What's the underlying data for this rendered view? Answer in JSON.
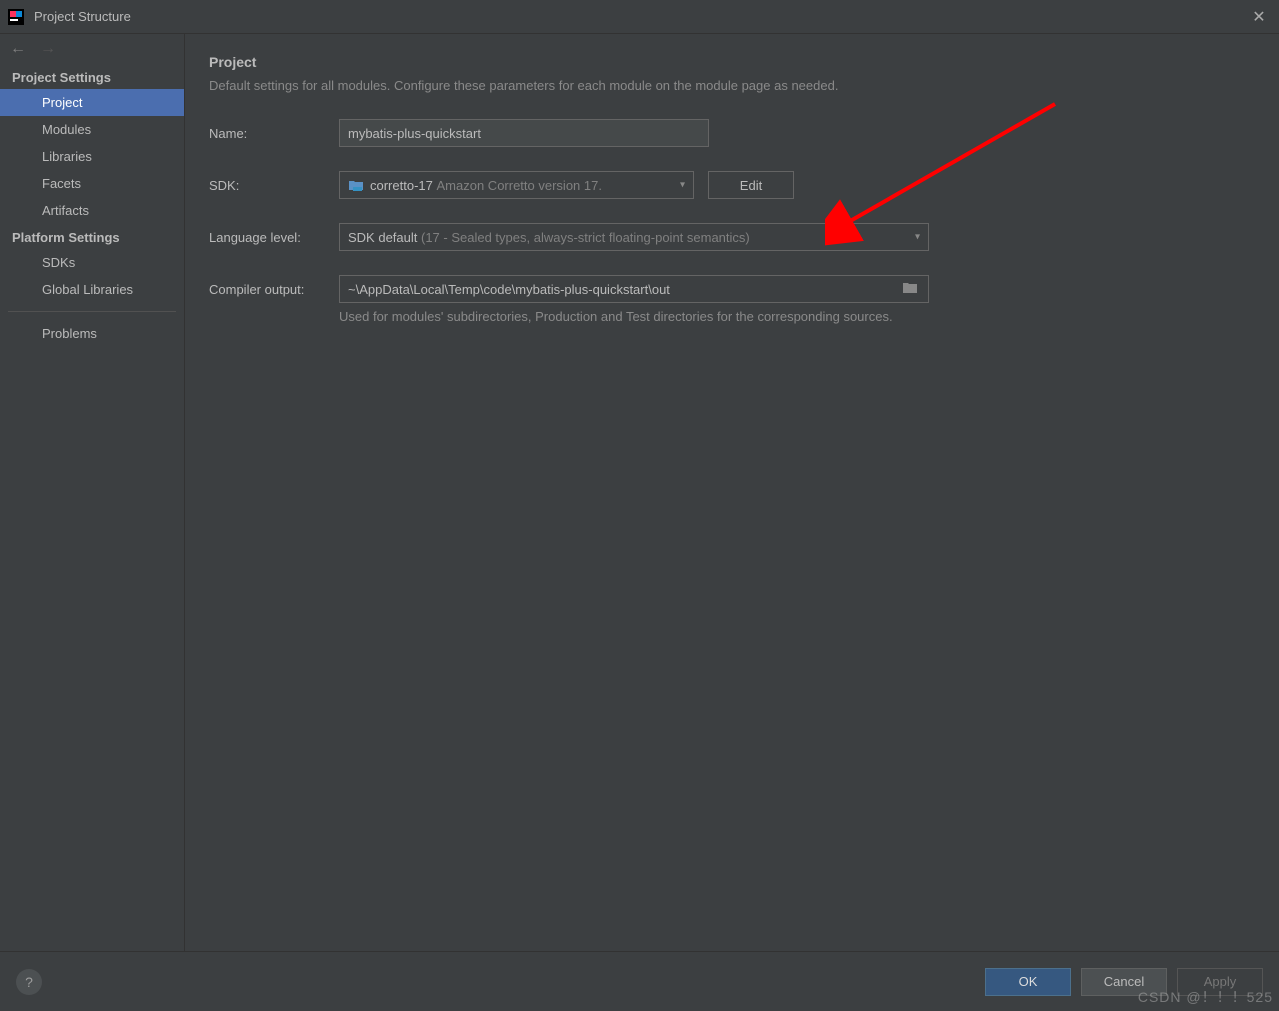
{
  "window": {
    "title": "Project Structure"
  },
  "sidebar": {
    "section1_label": "Project Settings",
    "section2_label": "Platform Settings",
    "items1": [
      "Project",
      "Modules",
      "Libraries",
      "Facets",
      "Artifacts"
    ],
    "items2": [
      "SDKs",
      "Global Libraries"
    ],
    "problems_label": "Problems",
    "selected": "Project"
  },
  "main": {
    "heading": "Project",
    "subtitle": "Default settings for all modules. Configure these parameters for each module on the module page as needed.",
    "name_label": "Name:",
    "name_value": "mybatis-plus-quickstart",
    "sdk_label": "SDK:",
    "sdk_name": "corretto-17",
    "sdk_detail": "Amazon Corretto version 17.",
    "edit_label": "Edit",
    "lang_label": "Language level:",
    "lang_value": "SDK default",
    "lang_detail": "(17 - Sealed types, always-strict floating-point semantics)",
    "output_label": "Compiler output:",
    "output_value": "~\\AppData\\Local\\Temp\\code\\mybatis-plus-quickstart\\out",
    "output_help": "Used for modules' subdirectories, Production and Test directories for the corresponding sources."
  },
  "footer": {
    "ok": "OK",
    "cancel": "Cancel",
    "apply": "Apply"
  },
  "watermark": "CSDN @！！！525"
}
